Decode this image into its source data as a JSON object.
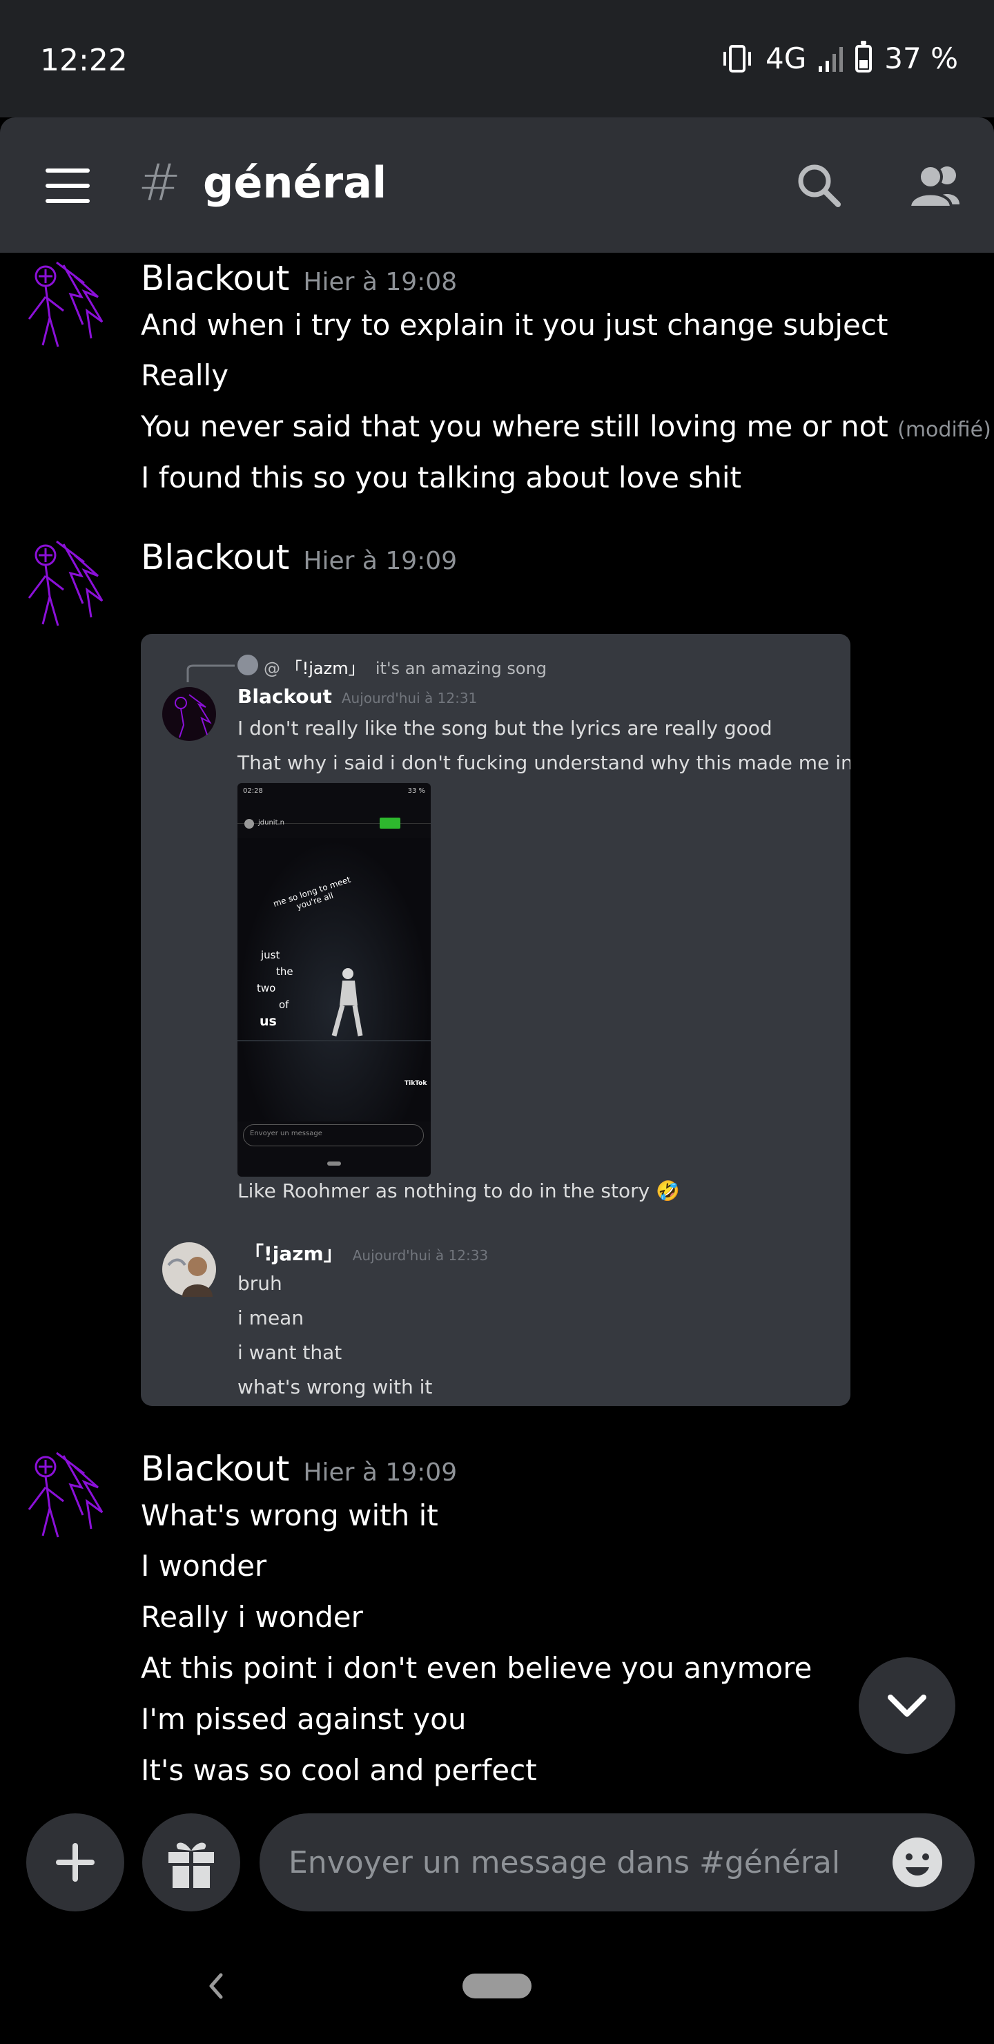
{
  "status_bar": {
    "time": "12:22",
    "network": "4G",
    "battery": "37 %",
    "battery_level": 0.37
  },
  "header": {
    "channel_hash": "#",
    "channel_name": "général"
  },
  "messages": [
    {
      "author": "Blackout",
      "timestamp": "Hier à 19:08",
      "lines": [
        "And when i try to explain it you just change subject",
        "Really",
        "You never said that you where still loving me or not",
        "I found this so you talking about love shit"
      ],
      "edited_label": "(modifié)"
    },
    {
      "author": "Blackout",
      "timestamp": "Hier à 19:09",
      "attachment": {
        "reply_prefix": "@",
        "reply_user": "「!jazm」",
        "reply_text": "it's an amazing song",
        "author1": "Blackout",
        "ts1": "Aujourd'hui à 12:31",
        "lines1": [
          "I don't really like the song but the lyrics are really good",
          "That why i said i don't fucking understand why this made me in pain"
        ],
        "phone": {
          "time": "02:28",
          "battery": "33 %",
          "user": "jdunit.n",
          "lyrics_arc": "me so long to meet you're all",
          "lyrics": [
            "just",
            "the",
            "two",
            "of",
            "us"
          ],
          "tiktok": "TikTok",
          "input_placeholder": "Envoyer un message"
        },
        "line_after_image": "Like Roohmer as nothing to do in the story",
        "emoji_after": "🤣",
        "author2": "「!jazm」",
        "ts2": "Aujourd'hui à 12:33",
        "lines2": [
          "bruh",
          "i mean",
          "i want that",
          "what's wrong with it"
        ]
      }
    },
    {
      "author": "Blackout",
      "timestamp": "Hier à 19:09",
      "lines": [
        "What's wrong with it",
        "I wonder",
        "Really i wonder",
        "At this point i don't even believe you anymore",
        "I'm pissed against you",
        "It's was so cool and perfect"
      ]
    }
  ],
  "composer": {
    "placeholder": "Envoyer un message dans #général"
  },
  "icons": {
    "menu": "hamburger-icon",
    "search": "search-icon",
    "members": "members-icon",
    "add": "plus-icon",
    "gift": "gift-icon",
    "emoji": "emoji-icon",
    "scroll": "chevron-down-icon",
    "nav_back": "back-icon"
  },
  "colors": {
    "background": "#000000",
    "surface": "#2f3136",
    "embed": "#36393f",
    "muted": "#8e9297",
    "avatar_accent": "#8b10d8"
  }
}
